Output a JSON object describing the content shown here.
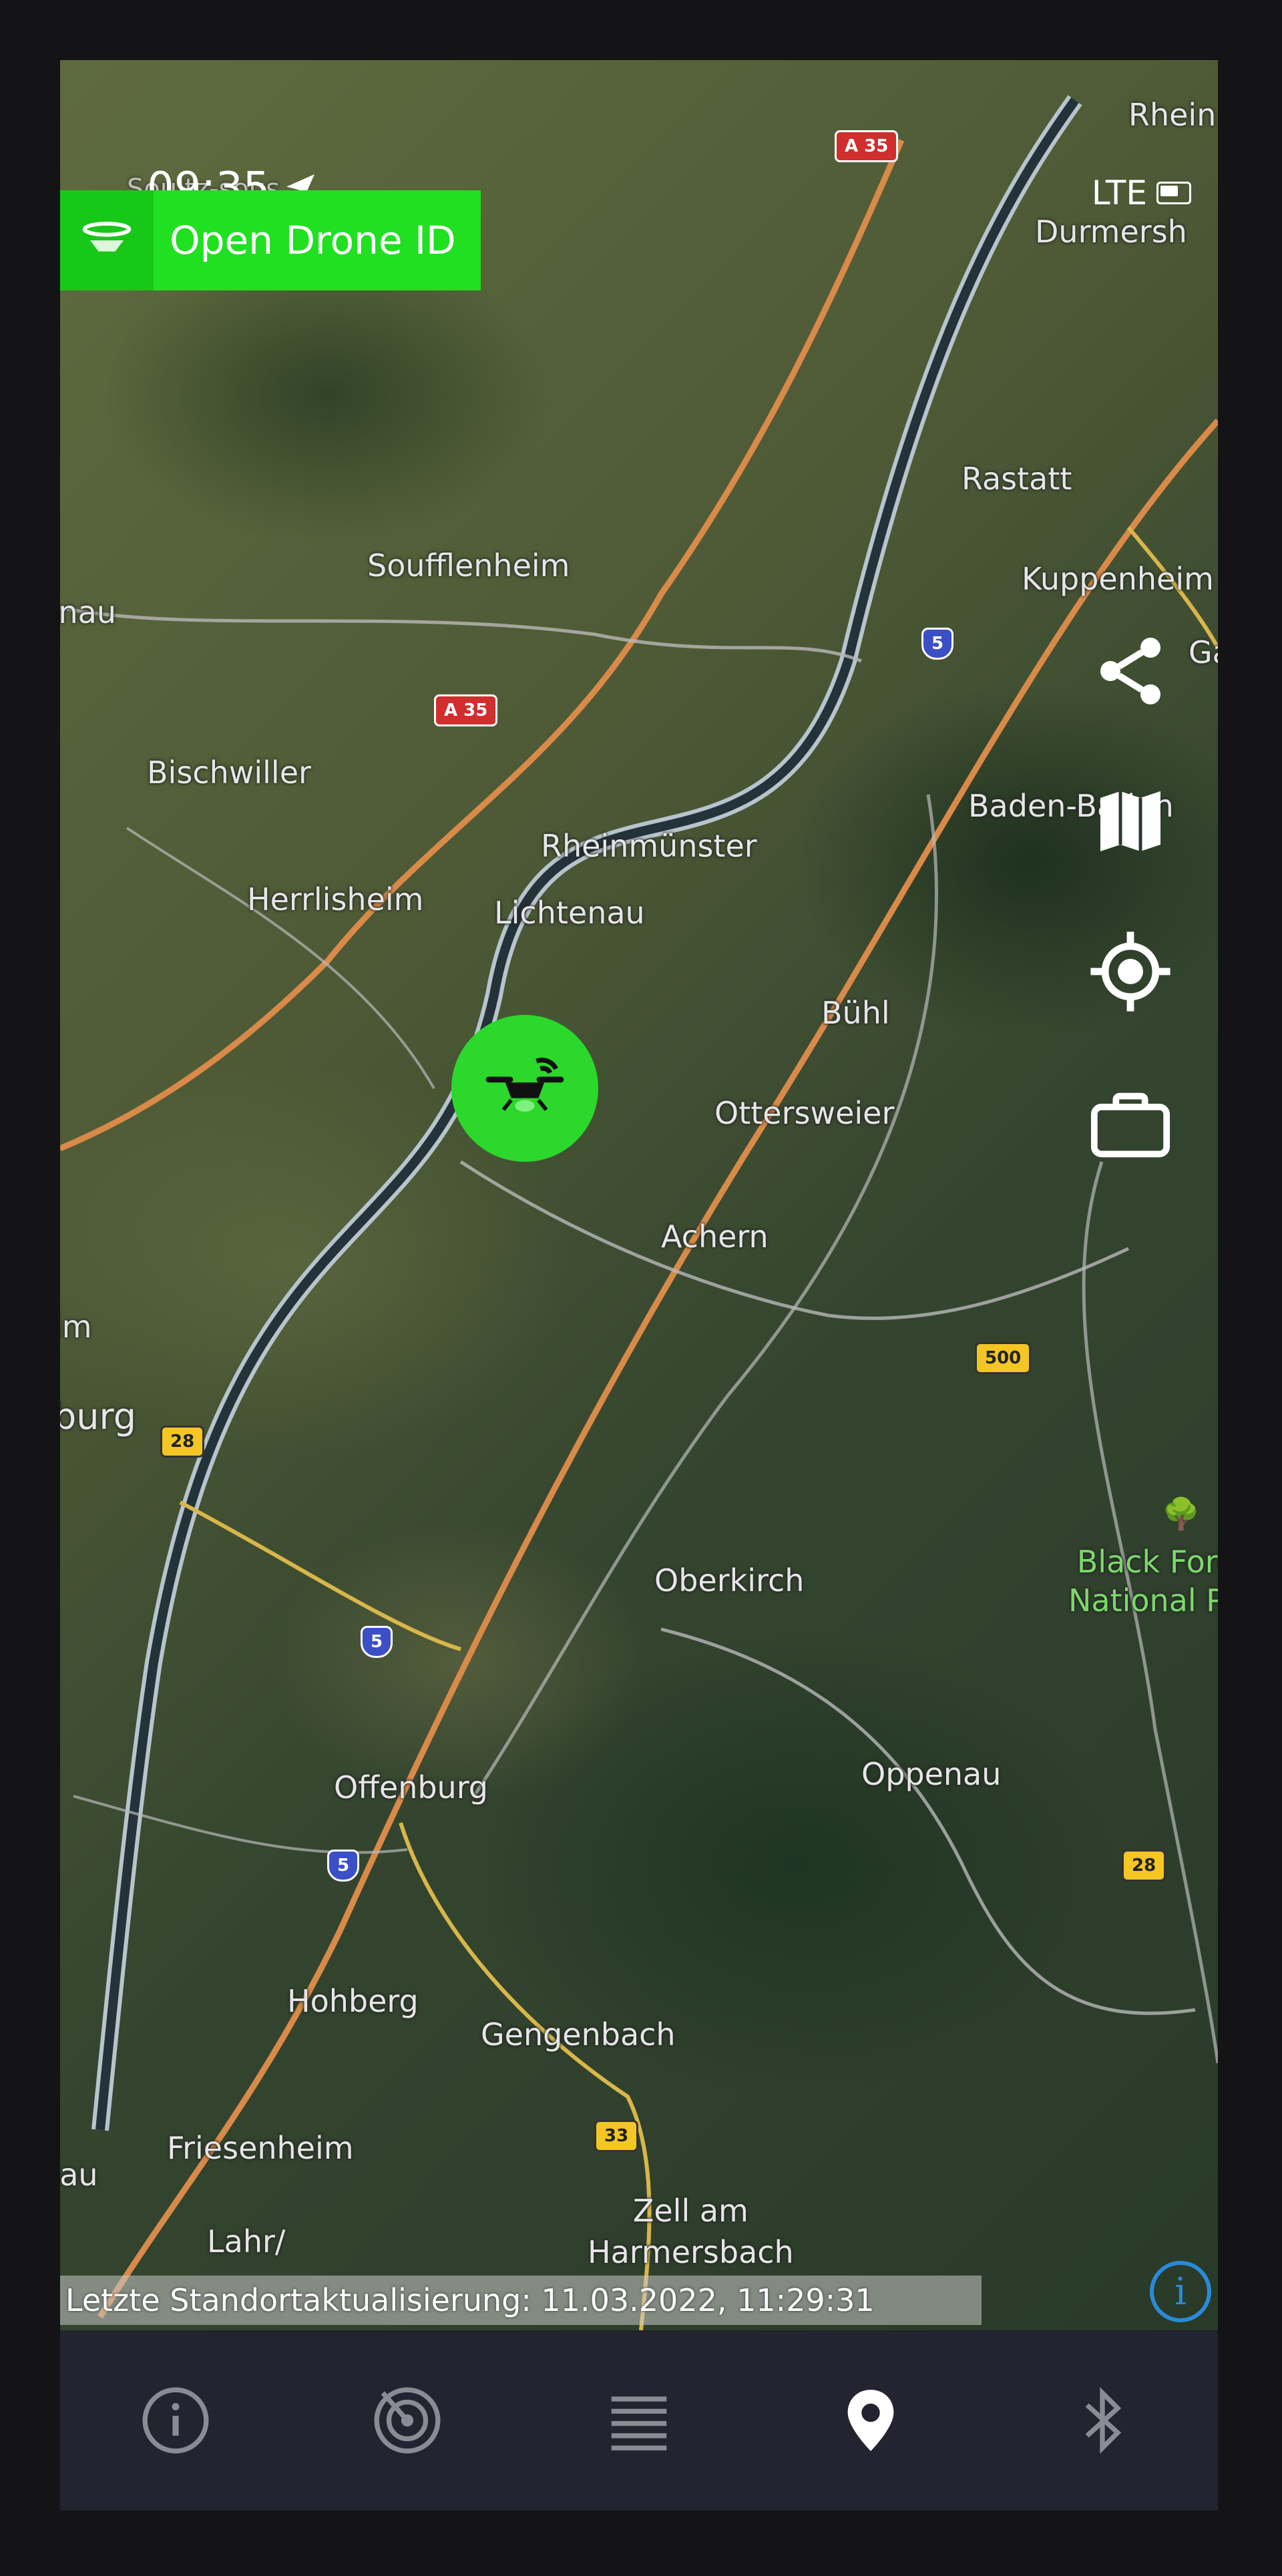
{
  "status_bar": {
    "time": "09:35",
    "network": "LTE"
  },
  "app": {
    "title": "Open Drone ID",
    "accent": "#21e021"
  },
  "map": {
    "places": [
      {
        "id": "durmersheim",
        "label": "Durmersh"
      },
      {
        "id": "rastatt",
        "label": "Rastatt"
      },
      {
        "id": "kuppenheim",
        "label": "Kuppenheim"
      },
      {
        "id": "soufflenheim",
        "label": "Soufflenheim"
      },
      {
        "id": "bischwiller",
        "label": "Bischwiller"
      },
      {
        "id": "baden",
        "label": "Baden-Baden"
      },
      {
        "id": "rheinmuenster",
        "label": "Rheinmünster"
      },
      {
        "id": "herrlisheim",
        "label": "Herrlisheim"
      },
      {
        "id": "lichtenau",
        "label": "Lichtenau"
      },
      {
        "id": "buehl",
        "label": "Bühl"
      },
      {
        "id": "ottersweier",
        "label": "Ottersweier"
      },
      {
        "id": "achern",
        "label": "Achern"
      },
      {
        "id": "oberkirch",
        "label": "Oberkirch"
      },
      {
        "id": "oppenau",
        "label": "Oppenau"
      },
      {
        "id": "offenburg",
        "label": "Offenburg"
      },
      {
        "id": "hohberg",
        "label": "Hohberg"
      },
      {
        "id": "gengenbach",
        "label": "Gengenbach"
      },
      {
        "id": "friesenheim",
        "label": "Friesenheim"
      },
      {
        "id": "lahr",
        "label": "Lahr/"
      },
      {
        "id": "zell",
        "label": "Zell am\nHarmersbach"
      },
      {
        "id": "burg",
        "label": "burg"
      },
      {
        "id": "gau",
        "label": "genau"
      },
      {
        "id": "rheinh",
        "label": "Rhein"
      },
      {
        "id": "bau",
        "label": "bau"
      },
      {
        "id": "im",
        "label": "im"
      },
      {
        "id": "ga",
        "label": "Ga"
      },
      {
        "id": "soultz",
        "label": "Soultz-sous"
      }
    ],
    "park": "Black Forest\nNational Park",
    "road_shields": {
      "a35_top": "A 35",
      "a35_mid": "A 35",
      "a5_top": "5",
      "a5_mid": "5",
      "a5_low": "5",
      "b500": "500",
      "b28a": "28",
      "b28b": "28",
      "b33": "33"
    }
  },
  "actions": {
    "share": "share-icon",
    "map_type": "map-icon",
    "locate": "crosshair-icon",
    "briefcase": "briefcase-icon"
  },
  "last_update": "Letzte Standortaktualisierung: 11.03.2022, 11:29:31",
  "nav": {
    "items": [
      "info",
      "radar",
      "list",
      "map",
      "bluetooth"
    ],
    "active": "map",
    "active_color": "#ffffff",
    "inactive_color": "#8a8b93"
  }
}
